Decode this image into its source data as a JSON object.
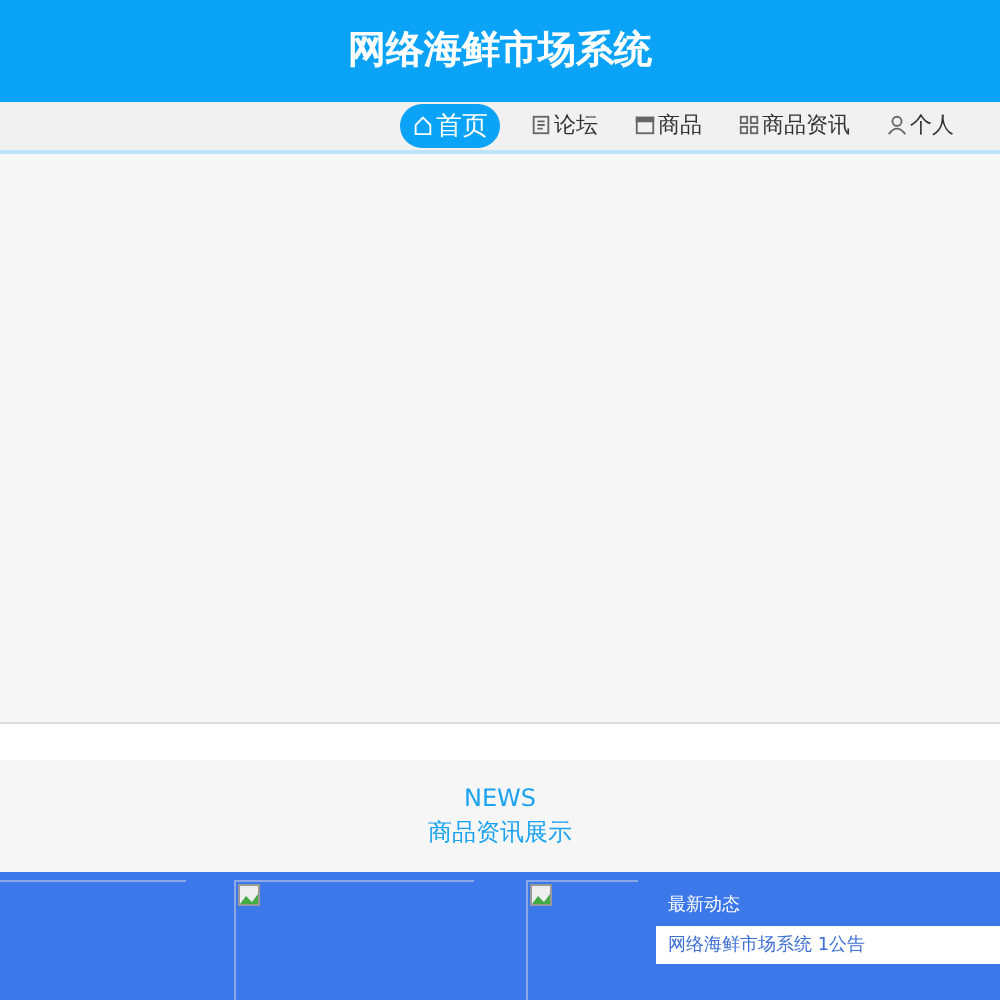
{
  "header": {
    "title": "网络海鲜市场系统"
  },
  "nav": [
    {
      "label": "首页",
      "selected": true
    },
    {
      "label": "论坛",
      "selected": false
    },
    {
      "label": "商品",
      "selected": false
    },
    {
      "label": "商品资讯",
      "selected": false
    },
    {
      "label": "个人",
      "selected": false
    }
  ],
  "news": {
    "kicker": "NEWS",
    "title": "商品资讯展示"
  },
  "latest": {
    "heading": "最新动态",
    "items": [
      "网络海鲜市场系统 1公告"
    ]
  }
}
